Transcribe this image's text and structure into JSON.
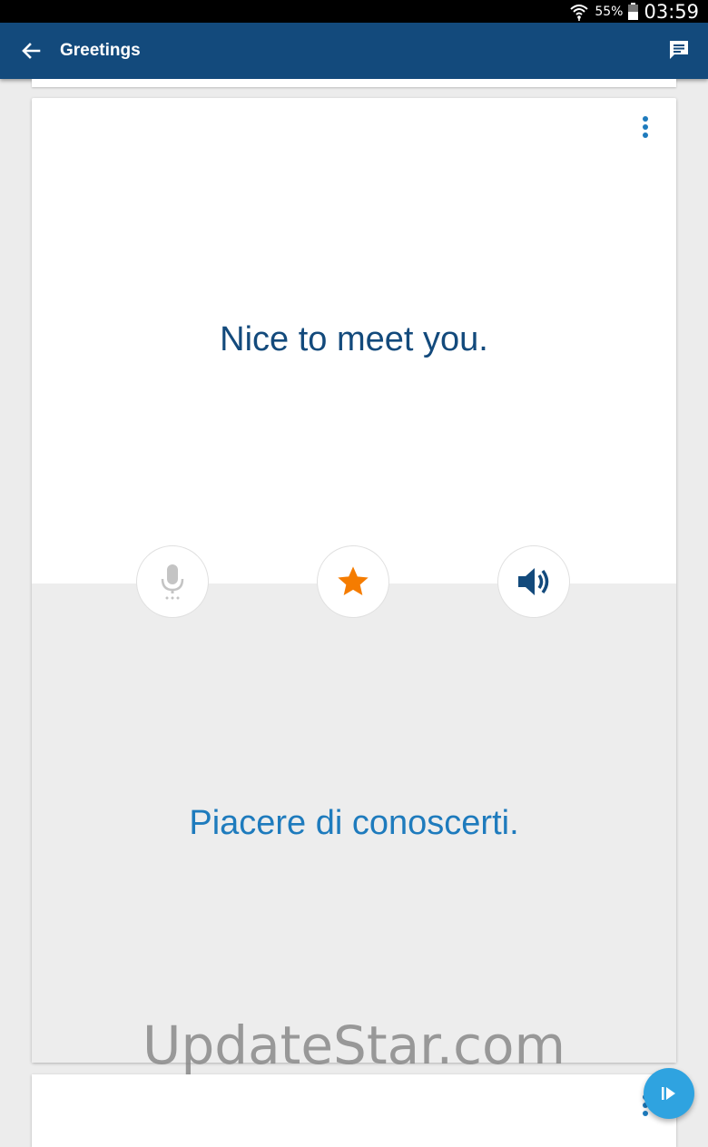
{
  "status_bar": {
    "battery_percent": "55%",
    "battery_level": 0.55,
    "time": "03:59",
    "icons": [
      "wifi-icon",
      "battery-icon"
    ]
  },
  "app_bar": {
    "title": "Greetings",
    "back_icon": "arrow-left-icon",
    "action_icon": "chat-bubble-icon",
    "color": "#134a7c"
  },
  "card": {
    "phrase": "Nice to meet you.",
    "translation": "Piacere di conoscerti.",
    "menu_icon": "more-vert-icon",
    "actions": [
      {
        "name": "microphone",
        "icon": "mic-icon",
        "state": "disabled"
      },
      {
        "name": "favorite",
        "icon": "star-icon",
        "color": "#f57c00"
      },
      {
        "name": "play-audio",
        "icon": "speaker-icon",
        "color": "#134a7c"
      }
    ]
  },
  "fab": {
    "icon": "play-next-icon",
    "color": "#2fa3e0"
  },
  "watermark": "UpdateStar.com"
}
